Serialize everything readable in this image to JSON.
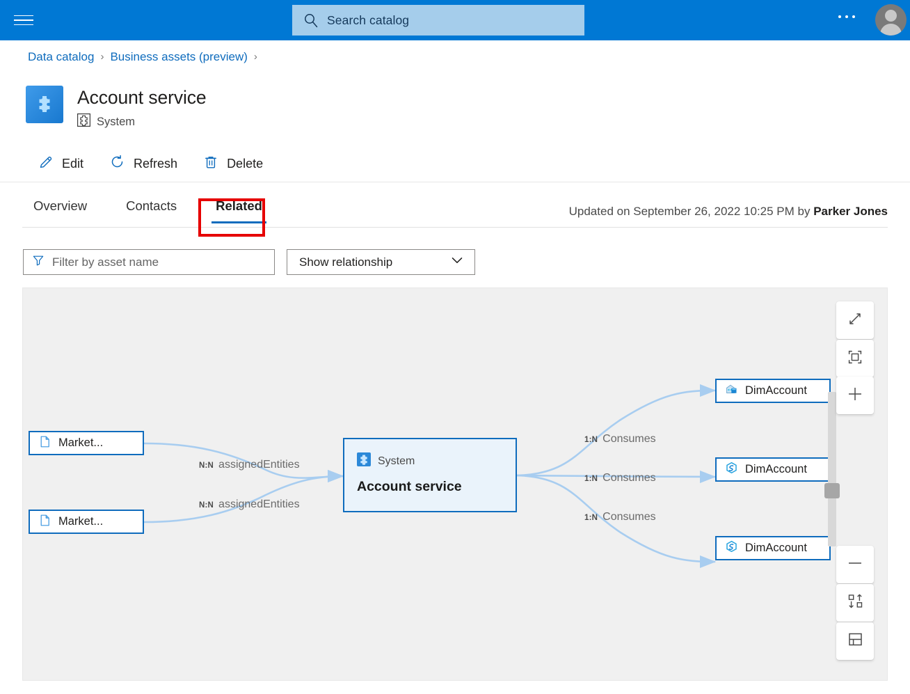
{
  "topbar": {
    "menu_icon": "hamburger-icon",
    "search": {
      "placeholder": "Search catalog",
      "icon": "search-icon"
    },
    "more_icon": "ellipsis-icon",
    "account_icon": "user-avatar-icon",
    "accent_color": "#0078d4"
  },
  "breadcrumb": {
    "items": [
      {
        "label": "Data catalog"
      },
      {
        "label": "Business assets (preview)"
      }
    ],
    "separator": "›"
  },
  "header": {
    "title": "Account service",
    "type_label": "System",
    "type_icon": "system-puzzle-icon",
    "asset_icon": "system-puzzle-tile-icon"
  },
  "commandbar": {
    "items": [
      {
        "label": "Edit",
        "icon": "pencil-icon"
      },
      {
        "label": "Refresh",
        "icon": "refresh-icon"
      },
      {
        "label": "Delete",
        "icon": "trash-icon"
      }
    ]
  },
  "tabs": {
    "items": [
      {
        "label": "Overview",
        "active": false
      },
      {
        "label": "Contacts",
        "active": false
      },
      {
        "label": "Related",
        "active": true
      }
    ],
    "active_accent": "#0f6cbd",
    "highlight_color": "#e60000"
  },
  "updated": {
    "prefix": "Updated on September 26, 2022 10:25 PM by ",
    "user": "Parker Jones"
  },
  "filters": {
    "asset_name": {
      "placeholder": "Filter by asset name",
      "value": "",
      "icon": "filter-funnel-icon"
    },
    "relationship": {
      "selected": "Show relationship",
      "icon": "chevron-down-icon"
    }
  },
  "graph": {
    "background": "#f0f0f0",
    "center_node": {
      "type_label": "System",
      "name": "Account service",
      "type_icon": "system-puzzle-icon"
    },
    "left_nodes": [
      {
        "label": "Market...",
        "icon": "document-icon"
      },
      {
        "label": "Market...",
        "icon": "document-icon"
      }
    ],
    "right_nodes": [
      {
        "label": "DimAccount",
        "icon": "data-warehouse-icon"
      },
      {
        "label": "DimAccount",
        "icon": "synapse-hexagon-icon"
      },
      {
        "label": "DimAccount",
        "icon": "synapse-hexagon-icon"
      }
    ],
    "left_edges": [
      {
        "cardinality": "N:N",
        "relationship": "assignedEntities"
      },
      {
        "cardinality": "N:N",
        "relationship": "assignedEntities"
      }
    ],
    "right_edges": [
      {
        "cardinality": "1:N",
        "relationship": "Consumes"
      },
      {
        "cardinality": "1:N",
        "relationship": "Consumes"
      },
      {
        "cardinality": "1:N",
        "relationship": "Consumes"
      }
    ],
    "controls": [
      {
        "name": "fullscreen-button",
        "icon": "expand-diagonal-icon"
      },
      {
        "name": "fit-to-screen-button",
        "icon": "fit-frame-icon"
      },
      {
        "name": "zoom-in-button",
        "icon": "plus-icon"
      },
      {
        "name": "zoom-out-button",
        "icon": "minus-icon"
      },
      {
        "name": "swap-direction-button",
        "icon": "swap-layout-icon"
      },
      {
        "name": "toggle-panel-button",
        "icon": "panel-layout-icon"
      }
    ]
  }
}
